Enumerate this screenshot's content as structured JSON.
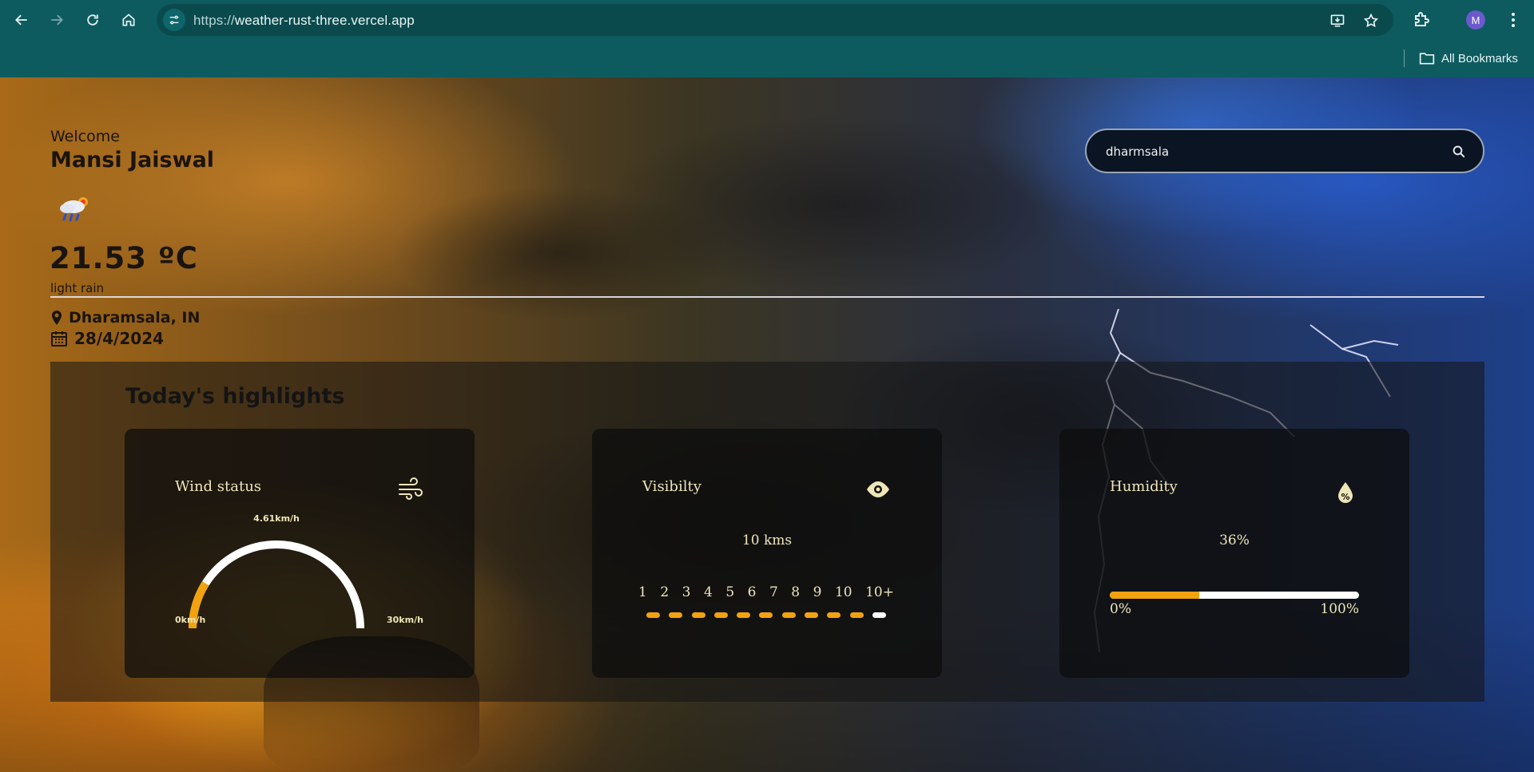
{
  "browser": {
    "url_scheme": "https://",
    "url_host": "weather-rust-three.vercel.app",
    "avatar_letter": "M",
    "bookmarks_label": "All Bookmarks"
  },
  "header": {
    "welcome": "Welcome",
    "user_name": "Mansi Jaiswal",
    "temperature": "21.53 ºC",
    "description": "light rain",
    "location": "Dharamsala, IN",
    "date": "28/4/2024"
  },
  "search": {
    "value": "dharmsala"
  },
  "highlights": {
    "title": "Today's highlights",
    "wind": {
      "title": "Wind status",
      "value": "4.61km/h",
      "min_label": "0km/h",
      "max_label": "30km/h",
      "speed": 4.61,
      "max": 30
    },
    "visibility": {
      "title": "Visibilty",
      "value": "10 kms",
      "scale": [
        "1",
        "2",
        "3",
        "4",
        "5",
        "6",
        "7",
        "8",
        "9",
        "10",
        "10+"
      ],
      "filled_segments": 10
    },
    "humidity": {
      "title": "Humidity",
      "value": "36%",
      "min_label": "0%",
      "max_label": "100%",
      "percent": 36
    }
  },
  "colors": {
    "accent": "#f2a20f",
    "card_text": "#efe6b8",
    "chrome": "#0d5b5f"
  }
}
